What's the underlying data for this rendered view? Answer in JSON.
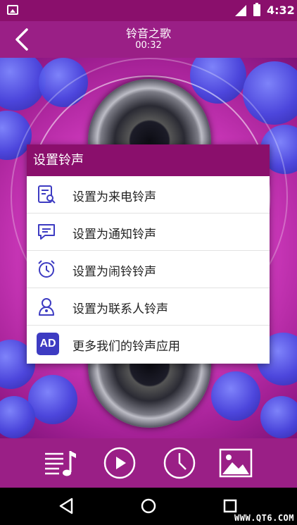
{
  "status_bar": {
    "time": "4:32"
  },
  "header": {
    "title": "铃音之歌",
    "duration": "00:32"
  },
  "dialog": {
    "title": "设置铃声",
    "options": [
      {
        "label": "设置为来电铃声",
        "icon": "phone-ringtone-icon"
      },
      {
        "label": "设置为通知铃声",
        "icon": "message-icon"
      },
      {
        "label": "设置为闹铃铃声",
        "icon": "alarm-clock-icon"
      },
      {
        "label": "设置为联系人铃声",
        "icon": "contact-icon"
      },
      {
        "label": "更多我们的铃声应用",
        "icon": "ad-icon",
        "badge": "AD"
      }
    ]
  },
  "toolbar": {
    "buttons": [
      "playlist-icon",
      "play-icon",
      "clock-icon",
      "image-icon"
    ]
  },
  "watermark": "WWW.QT6.COM",
  "colors": {
    "accent": "#9a1f86",
    "dark_accent": "#8a0f6c",
    "ad_badge": "#3d3bc2"
  }
}
